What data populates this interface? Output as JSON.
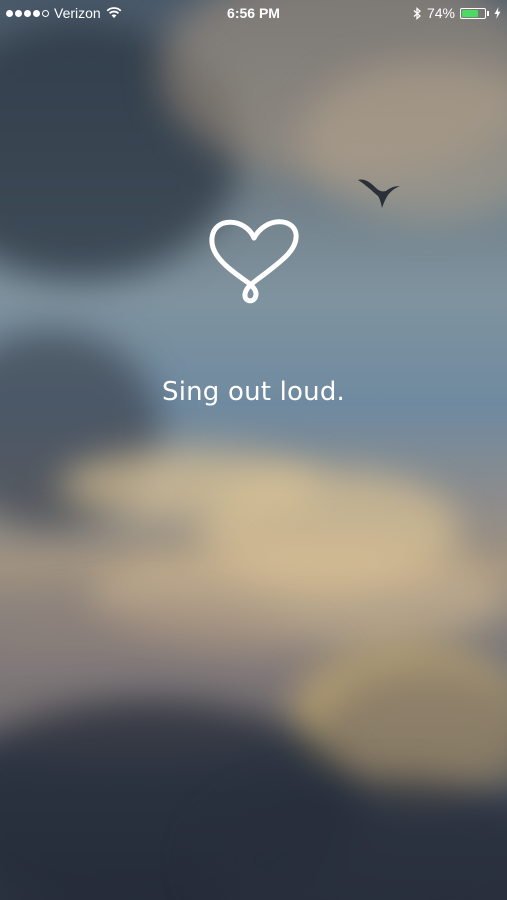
{
  "status_bar": {
    "carrier": "Verizon",
    "time": "6:56 PM",
    "battery_percent": "74%",
    "battery_level": 0.74,
    "signal_bars_filled": 4,
    "signal_bars_total": 5,
    "icons": [
      "wifi-icon",
      "bluetooth-icon",
      "battery-icon",
      "charging-bolt-icon"
    ]
  },
  "splash": {
    "logo_icon": "heart-logo-icon",
    "tagline": "Sing out loud."
  },
  "colors": {
    "battery_green": "#4cd964",
    "text": "#ffffff"
  }
}
